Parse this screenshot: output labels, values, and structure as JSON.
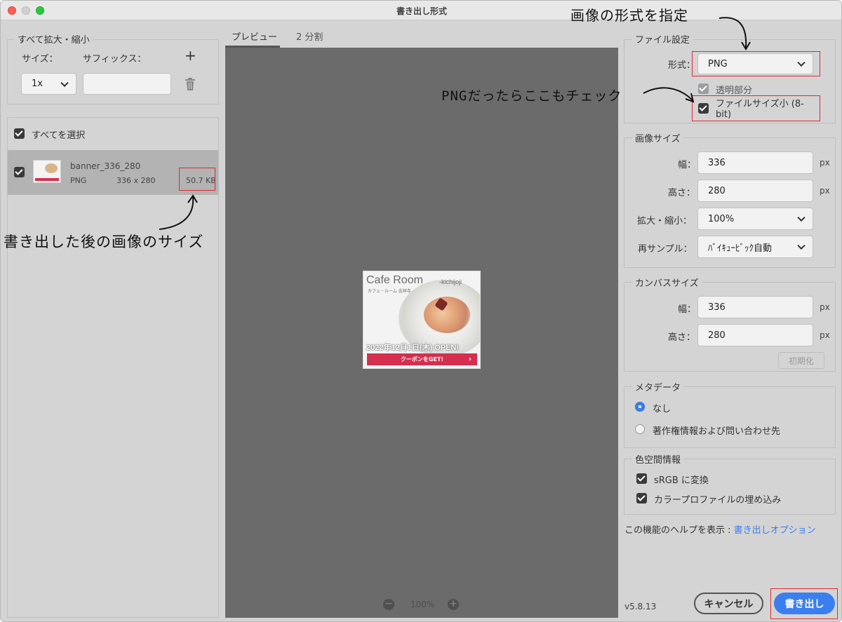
{
  "window": {
    "title": "書き出し形式"
  },
  "left": {
    "scale_group": {
      "legend": "すべて拡大・縮小",
      "size_label": "サイズ：",
      "suffix_label": "サフィックス：",
      "size_value": "1x",
      "suffix_value": ""
    },
    "select_all_label": "すべてを選択",
    "asset": {
      "name": "banner_336_280",
      "format": "PNG",
      "dimensions": "336 x 280",
      "filesize": "50.7 KB"
    }
  },
  "tabs": [
    {
      "label": "プレビュー"
    },
    {
      "label": "2 分割"
    }
  ],
  "banner": {
    "brand": "Cafe Room",
    "sub": "-kichijoji",
    "sub_jp": "カフェ・ルーム 吉祥寺",
    "date": "2022年12月1日(木) OPEN!",
    "coupon": "クーポンをGET!",
    "coupon_arrow": "›"
  },
  "zoom": {
    "value": "100%",
    "minus": "−",
    "plus": "+"
  },
  "right": {
    "file_settings": {
      "legend": "ファイル設定",
      "format_label": "形式：",
      "format_value": "PNG",
      "transparency_label": "透明部分",
      "small_file_label_1": "ファイルサイズ小 (8-",
      "small_file_label_2": "bit)"
    },
    "image_size": {
      "legend": "画像サイズ",
      "width_label": "幅：",
      "width_value": "336",
      "height_label": "高さ：",
      "height_value": "280",
      "scale_label": "拡大・縮小：",
      "scale_value": "100%",
      "resample_label": "再サンプル：",
      "resample_value": "ﾊﾞｲｷｭｰﾋﾞｯｸ自動",
      "unit": "px"
    },
    "canvas_size": {
      "legend": "カンバスサイズ",
      "width_label": "幅：",
      "width_value": "336",
      "height_label": "高さ：",
      "height_value": "280",
      "unit": "px",
      "reset_label": "初期化"
    },
    "metadata": {
      "legend": "メタデータ",
      "option_none": "なし",
      "option_copyright": "著作権情報および問い合わせ先"
    },
    "color_space": {
      "legend": "色空間情報",
      "srgb_label": "sRGB に変換",
      "embed_label": "カラープロファイルの埋め込み"
    },
    "help": {
      "text": "この機能のヘルプを表示 : ",
      "link": "書き出しオプション"
    },
    "version": "v5.8.13",
    "cancel_label": "キャンセル",
    "export_label": "書き出し"
  },
  "annotations": {
    "format_note": "画像の形式を指定",
    "png_note": "PNGだったらここもチェック",
    "size_note": "書き出した後の画像のサイズ"
  },
  "colors": {
    "accent": "#3a7ff0",
    "annotation_red": "#e0282e",
    "coupon_red": "#d42f4f"
  }
}
